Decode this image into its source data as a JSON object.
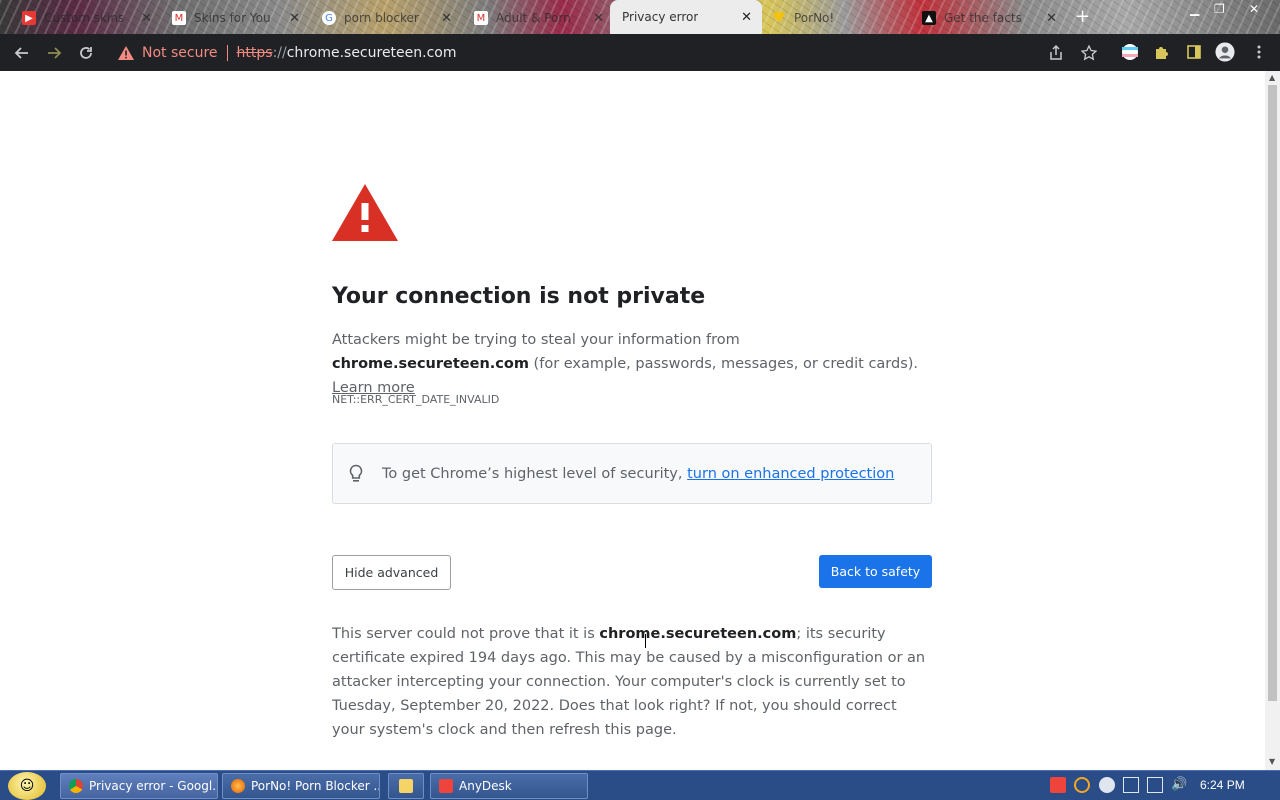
{
  "tabs": [
    {
      "title": "Custom skins",
      "favicon": "youtube-kids-icon"
    },
    {
      "title": "Skins for You",
      "favicon": "gmail-icon"
    },
    {
      "title": "porn blocker",
      "favicon": "google-icon"
    },
    {
      "title": "Adult & Porn",
      "favicon": "gmail-icon"
    },
    {
      "title": "Privacy error",
      "favicon": "none",
      "active": true
    },
    {
      "title": "PorNo!",
      "favicon": "heart-icon"
    },
    {
      "title": "Get the facts",
      "favicon": "site-icon"
    }
  ],
  "toolbar": {
    "security_label": "Not secure",
    "url_scheme": "https",
    "url_sep": "://",
    "url_host": "chrome.secureteen.com"
  },
  "page": {
    "heading": "Your connection is not private",
    "intro_prefix": "Attackers might be trying to steal your information from ",
    "intro_host": "chrome.secureteen.com",
    "intro_suffix": " (for example, passwords, messages, or credit cards). ",
    "learn_more": "Learn more",
    "error_code": "NET::ERR_CERT_DATE_INVALID",
    "enhanced_prefix": "To get Chrome’s highest level of security, ",
    "enhanced_link": "turn on enhanced protection",
    "hide_advanced": "Hide advanced",
    "back_to_safety": "Back to safety",
    "details_prefix": "This server could not prove that it is ",
    "details_host": "chrome.secureteen.com",
    "details_suffix": "; its security certificate expired 194 days ago. This may be caused by a misconfiguration or an attacker intercepting your connection. Your computer's clock is currently set to Tuesday, September 20, 2022. Does that look right? If not, you should correct your system's clock and then refresh this page."
  },
  "taskbar": {
    "tasks": [
      {
        "label": "Privacy error - Googl...",
        "icon": "chrome-icon"
      },
      {
        "label": "PorNo! Porn Blocker ...",
        "icon": "firefox-icon"
      },
      {
        "label": "",
        "icon": "folder-icon"
      },
      {
        "label": "AnyDesk",
        "icon": "anydesk-icon"
      }
    ],
    "clock": "6:24 PM"
  },
  "colors": {
    "accent": "#1a73e8",
    "warning": "#d93025",
    "toolbar_bg": "#202124",
    "taskbar_bg": "#2b4d87"
  }
}
